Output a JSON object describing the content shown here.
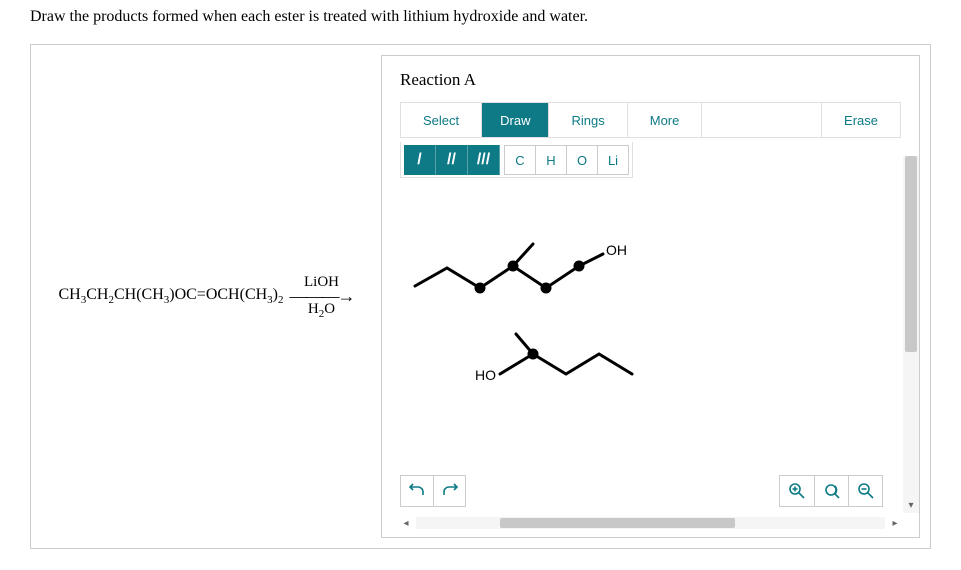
{
  "prompt": "Draw the products formed when each ester is treated with lithium hydroxide and water.",
  "reaction": {
    "reactant_html": "CH<sub>3</sub>CH<sub>2</sub>CH(CH<sub>3</sub>)OC=OCH(CH<sub>3</sub>)<sub>2</sub>",
    "reagent_top": "LiOH",
    "reagent_bottom_html": "H<sub>2</sub>O"
  },
  "panel": {
    "title": "Reaction A",
    "tabs": {
      "select": "Select",
      "draw": "Draw",
      "rings": "Rings",
      "more": "More",
      "erase": "Erase"
    },
    "bonds": {
      "single": "/",
      "double": "//",
      "triple": "///"
    },
    "atoms": [
      "C",
      "H",
      "O",
      "Li"
    ],
    "labels": {
      "oh_top": "OH",
      "ho_bottom": "HO"
    }
  }
}
